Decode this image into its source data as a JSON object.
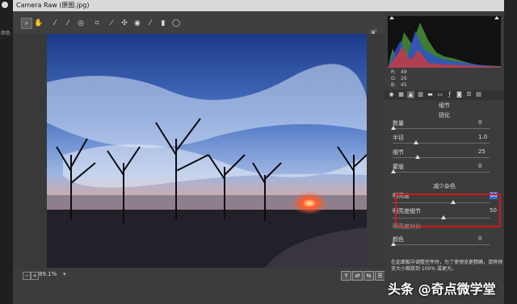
{
  "window": {
    "title": "Camera Raw (原图.jpg)"
  },
  "side_left": {
    "top_char": "ɑ",
    "label": "颜色 ·"
  },
  "toolbar": {
    "tools": [
      "zoom-icon",
      "hand-icon",
      "white-balance-icon",
      "color-sampler-icon",
      "targeted-adjust-icon",
      "crop-icon",
      "straighten-icon",
      "spot-removal-icon",
      "red-eye-icon",
      "brush-icon",
      "graduated-filter-icon",
      "radial-filter-icon"
    ]
  },
  "histogram": {
    "r_label": "R:",
    "r": "49",
    "g_label": "G:",
    "g": "26",
    "b_label": "B:",
    "b": "45"
  },
  "panel": {
    "tab_title": "细节",
    "sharpen": {
      "title": "锐化",
      "amount_label": "数量",
      "amount": "0",
      "radius_label": "半径",
      "radius": "1.0",
      "detail_label": "细节",
      "detail": "25",
      "masking_label": "蒙版",
      "masking": "0"
    },
    "noise": {
      "title": "减少杂色",
      "lum_label": "明亮度",
      "lum": "60",
      "lumdetail_label": "明亮度细节",
      "lumdetail": "50",
      "lumcontrast_label": "明亮度对比",
      "color_label": "颜色",
      "color": "0"
    },
    "note": "在此面板中调整控件时，为了使预览更精确，请将预览大小缩放到 100% 或更大。"
  },
  "bottom": {
    "zoom": "89.1%",
    "zoom_dd": "▾",
    "view_y": "Y"
  },
  "watermark": "头条 @奇点微学堂"
}
